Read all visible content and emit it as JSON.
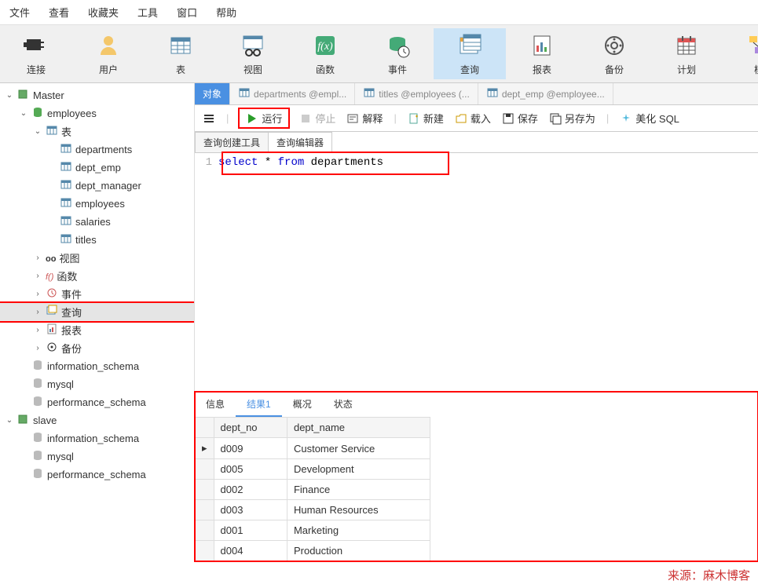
{
  "menu": [
    "文件",
    "查看",
    "收藏夹",
    "工具",
    "窗口",
    "帮助"
  ],
  "toolbar": [
    {
      "label": "连接",
      "icon": "plug"
    },
    {
      "label": "用户",
      "icon": "user"
    },
    {
      "label": "表",
      "icon": "table"
    },
    {
      "label": "视图",
      "icon": "view"
    },
    {
      "label": "函数",
      "icon": "fx"
    },
    {
      "label": "事件",
      "icon": "event"
    },
    {
      "label": "查询",
      "icon": "query",
      "active": true
    },
    {
      "label": "报表",
      "icon": "report"
    },
    {
      "label": "备份",
      "icon": "backup"
    },
    {
      "label": "计划",
      "icon": "schedule"
    },
    {
      "label": "模",
      "icon": "model"
    }
  ],
  "tree": {
    "master": "Master",
    "employees_db": "employees",
    "tables_label": "表",
    "tables": [
      "departments",
      "dept_emp",
      "dept_manager",
      "employees",
      "salaries",
      "titles"
    ],
    "nodes": [
      {
        "label": "视图",
        "icon": "oo"
      },
      {
        "label": "函数",
        "icon": "fx"
      },
      {
        "label": "事件",
        "icon": "ev"
      },
      {
        "label": "查询",
        "icon": "qr",
        "hl": true
      },
      {
        "label": "报表",
        "icon": "rp"
      },
      {
        "label": "备份",
        "icon": "bk"
      }
    ],
    "sysdbs": [
      "information_schema",
      "mysql",
      "performance_schema"
    ],
    "slave": "slave",
    "slave_dbs": [
      "information_schema",
      "mysql",
      "performance_schema"
    ]
  },
  "tabs": [
    {
      "label": "对象",
      "active": true
    },
    {
      "label": "departments @empl..."
    },
    {
      "label": "titles @employees (..."
    },
    {
      "label": "dept_emp @employee..."
    }
  ],
  "actions": {
    "run": "运行",
    "stop": "停止",
    "explain": "解释",
    "new": "新建",
    "load": "载入",
    "save": "保存",
    "saveas": "另存为",
    "beautify": "美化 SQL"
  },
  "subtabs": [
    "查询创建工具",
    "查询编辑器"
  ],
  "editor": {
    "line": "1",
    "sql": "select * from departments"
  },
  "restabs": [
    "信息",
    "结果1",
    "概况",
    "状态"
  ],
  "grid": {
    "cols": [
      "dept_no",
      "dept_name"
    ],
    "rows": [
      [
        "d009",
        "Customer Service"
      ],
      [
        "d005",
        "Development"
      ],
      [
        "d002",
        "Finance"
      ],
      [
        "d003",
        "Human Resources"
      ],
      [
        "d001",
        "Marketing"
      ],
      [
        "d004",
        "Production"
      ]
    ]
  },
  "watermark": "来源：麻木博客"
}
